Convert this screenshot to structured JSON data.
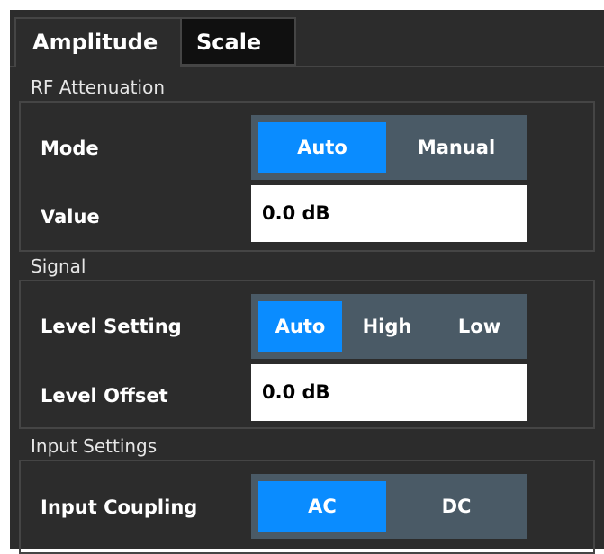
{
  "tabs": [
    {
      "label": "Amplitude",
      "active": true
    },
    {
      "label": "Scale",
      "active": false
    }
  ],
  "groups": {
    "rf_attenuation": {
      "title": "RF Attenuation",
      "mode": {
        "label": "Mode",
        "options": [
          "Auto",
          "Manual"
        ],
        "selected": "Auto"
      },
      "value": {
        "label": "Value",
        "value": "0.0 dB"
      }
    },
    "signal": {
      "title": "Signal",
      "level_setting": {
        "label": "Level Setting",
        "options": [
          "Auto",
          "High",
          "Low"
        ],
        "selected": "Auto"
      },
      "level_offset": {
        "label": "Level Offset",
        "value": "0.0 dB"
      }
    },
    "input_settings": {
      "title": "Input Settings",
      "input_coupling": {
        "label": "Input Coupling",
        "options": [
          "AC",
          "DC"
        ],
        "selected": "AC"
      }
    }
  },
  "colors": {
    "panel_bg": "#2c2c2c",
    "border": "#454545",
    "active_blue": "#0a8cff",
    "segment_bg": "#4a5a66"
  }
}
